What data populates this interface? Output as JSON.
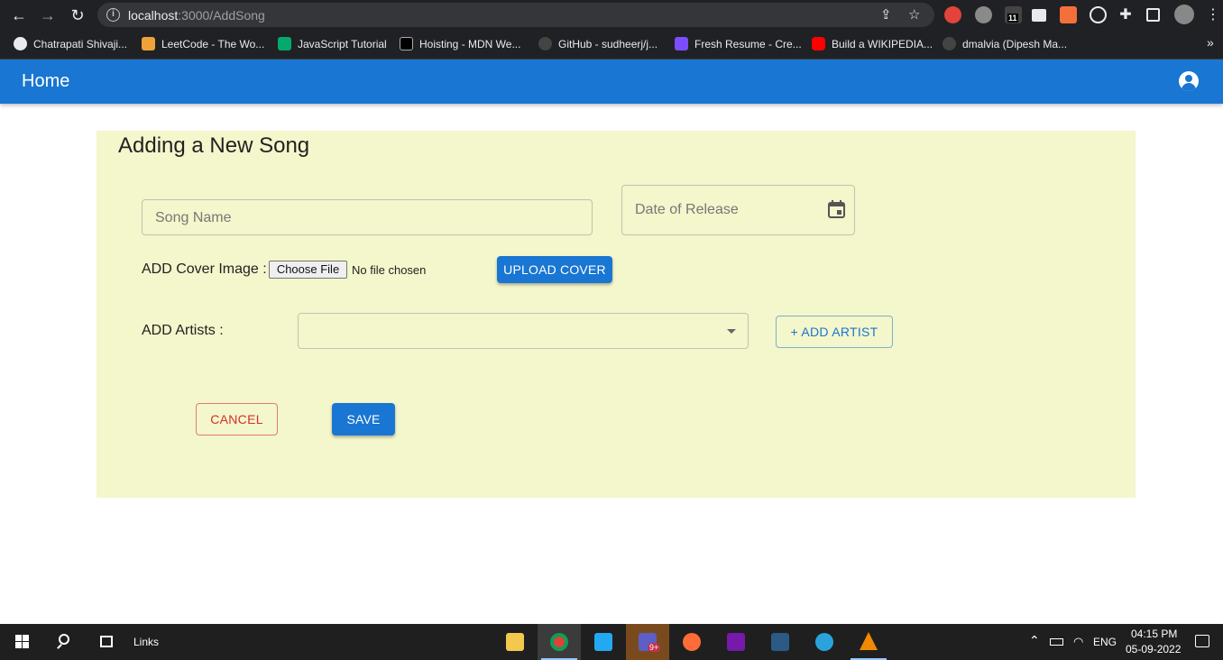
{
  "browser": {
    "url_host": "localhost",
    "url_rest": ":3000/AddSong",
    "bookmarks": [
      {
        "label": "Chatrapati Shivaji...",
        "icon": "globe-icon",
        "color": "#e8eaed"
      },
      {
        "label": "LeetCode - The Wo...",
        "icon": "leetcode-icon",
        "color": "#f0a13a"
      },
      {
        "label": "JavaScript Tutorial",
        "icon": "w3schools-icon",
        "color": "#04aa6d"
      },
      {
        "label": "Hoisting - MDN We...",
        "icon": "mdn-icon",
        "color": "#000000"
      },
      {
        "label": "GitHub - sudheerj/j...",
        "icon": "github-icon",
        "color": "#444444"
      },
      {
        "label": "Fresh Resume - Cre...",
        "icon": "fresh-resume-icon",
        "color": "#7c4dff"
      },
      {
        "label": "Build a WIKIPEDIA...",
        "icon": "youtube-icon",
        "color": "#ff0000"
      },
      {
        "label": "dmalvia (Dipesh Ma...",
        "icon": "github-icon",
        "color": "#444444"
      }
    ],
    "more_bookmarks": "»",
    "extension_badge": "11"
  },
  "appbar": {
    "title": "Home",
    "color": "#1976d2"
  },
  "form": {
    "title": "Adding a New Song",
    "song_name_placeholder": "Song Name",
    "date_placeholder": "Date of Release",
    "cover_label": "ADD Cover Image :",
    "choose_file_label": "Choose File",
    "no_file_text": "No file chosen",
    "upload_cover_label": "UPLOAD COVER",
    "artists_label": "ADD Artists :",
    "artists_value": "",
    "add_artist_label": "+ ADD ARTIST",
    "cancel_label": "CANCEL",
    "save_label": "SAVE",
    "panel_color": "#f4f6cb",
    "cancel_color": "#d32f2f"
  },
  "taskbar": {
    "search_label": "Links",
    "language": "ENG",
    "time": "04:15 PM",
    "date": "05-09-2022",
    "teams_badge": "9+"
  }
}
